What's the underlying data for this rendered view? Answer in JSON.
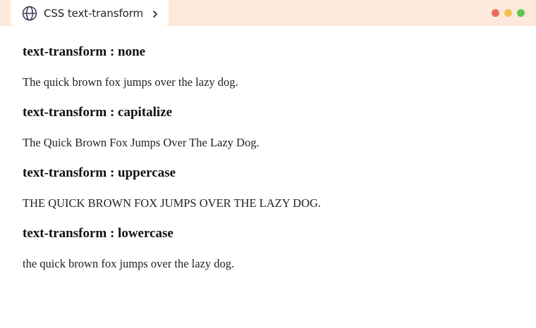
{
  "tab": {
    "title": "CSS text-transform",
    "icon": "globe-icon"
  },
  "window_controls": {
    "close_color": "#ec6a5e",
    "minimize_color": "#f4bf4f",
    "maximize_color": "#61c554"
  },
  "colors": {
    "topbar": "#fde9dc",
    "tab": "#ffffff"
  },
  "sections": [
    {
      "heading": "text-transform : none",
      "text": "The quick brown fox jumps over the lazy dog."
    },
    {
      "heading": "text-transform : capitalize",
      "text": "The Quick Brown Fox Jumps Over The Lazy Dog."
    },
    {
      "heading": "text-transform : uppercase",
      "text": "THE QUICK BROWN FOX JUMPS OVER THE LAZY DOG."
    },
    {
      "heading": "text-transform : lowercase",
      "text": "the quick brown fox jumps over the lazy dog."
    }
  ]
}
